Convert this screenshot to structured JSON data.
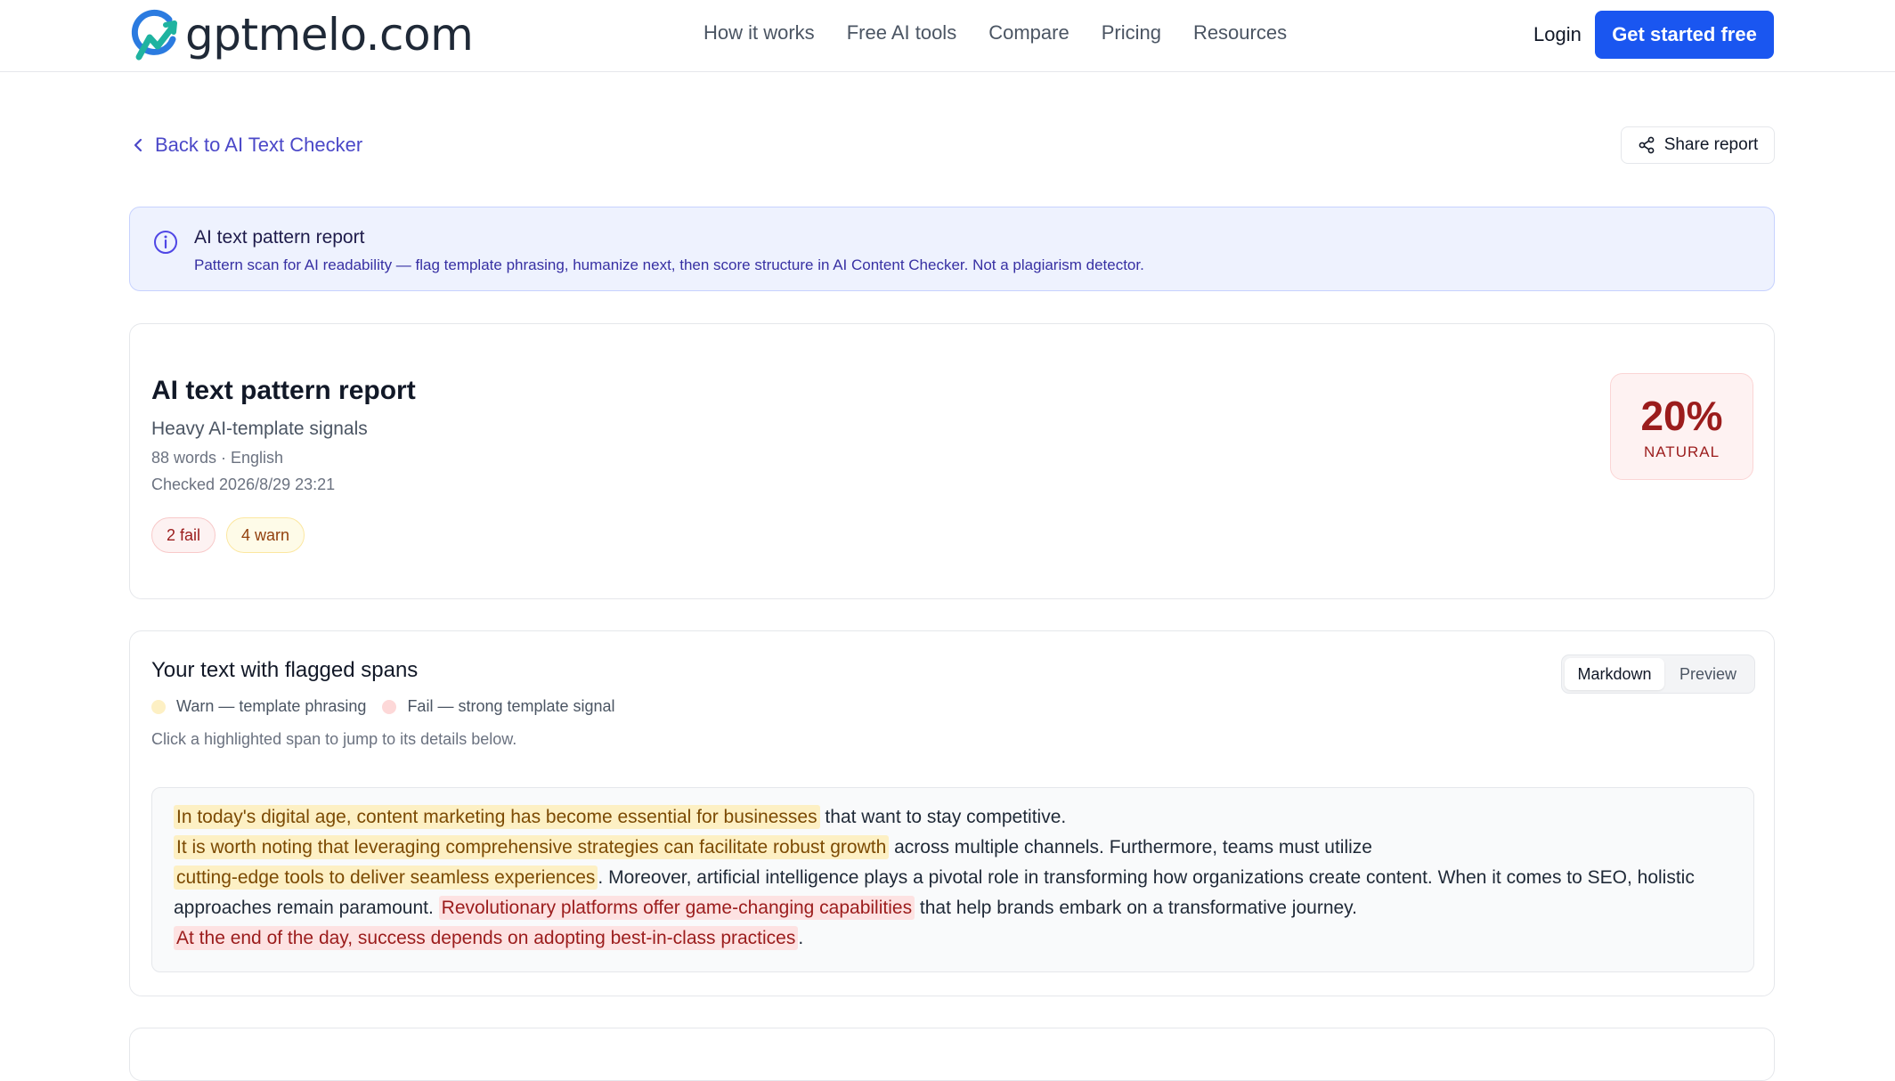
{
  "header": {
    "logo_text": "gptmelo.com",
    "nav": [
      "How it works",
      "Free AI tools",
      "Compare",
      "Pricing",
      "Resources"
    ],
    "login_label": "Login",
    "cta_label": "Get started free"
  },
  "subbar": {
    "back_label": "Back to AI Text Checker",
    "share_label": "Share report"
  },
  "banner": {
    "title": "AI text pattern report",
    "text": "Pattern scan for AI readability — flag template phrasing, humanize next, then score structure in AI Content Checker. Not a plagiarism detector."
  },
  "report": {
    "title": "AI text pattern report",
    "subtitle": "Heavy AI-template signals",
    "meta": "88 words · English",
    "checked": "Checked 2026/8/29 23:21",
    "fail_badge": "2 fail",
    "warn_badge": "4 warn",
    "score_value": "20%",
    "score_label": "NATURAL"
  },
  "text_panel": {
    "title": "Your text with flagged spans",
    "legend_warn": "Warn — template phrasing",
    "legend_fail": "Fail — strong template signal",
    "hint": "Click a highlighted span to jump to its details below.",
    "toggle_markdown": "Markdown",
    "toggle_preview": "Preview",
    "segments": {
      "s1": "In today's digital age, content marketing has become essential for businesses",
      "s2": " that want to stay competitive.",
      "s3": "It is worth noting that leveraging comprehensive strategies can facilitate robust growth",
      "s4": " across multiple channels. Furthermore, teams must utilize",
      "s5": "cutting-edge tools to deliver seamless experiences",
      "s6": ". Moreover, artificial intelligence plays a pivotal role in transforming how organizations create content. When it comes to SEO, holistic approaches remain paramount. ",
      "s7": "Revolutionary platforms offer game-changing capabilities",
      "s8": " that help brands embark on a transformative journey.",
      "s9": "At the end of the day, success depends on adopting best-in-class practices",
      "s10": "."
    }
  },
  "colors": {
    "primary": "#1a56f0",
    "link": "#4b48c8",
    "warn_bg": "#fdf0c4",
    "fail_bg": "#fde2e2",
    "score_red": "#9b1c1c"
  },
  "icons": {
    "back": "chevron-left-icon",
    "share": "share-icon",
    "info": "info-icon"
  }
}
